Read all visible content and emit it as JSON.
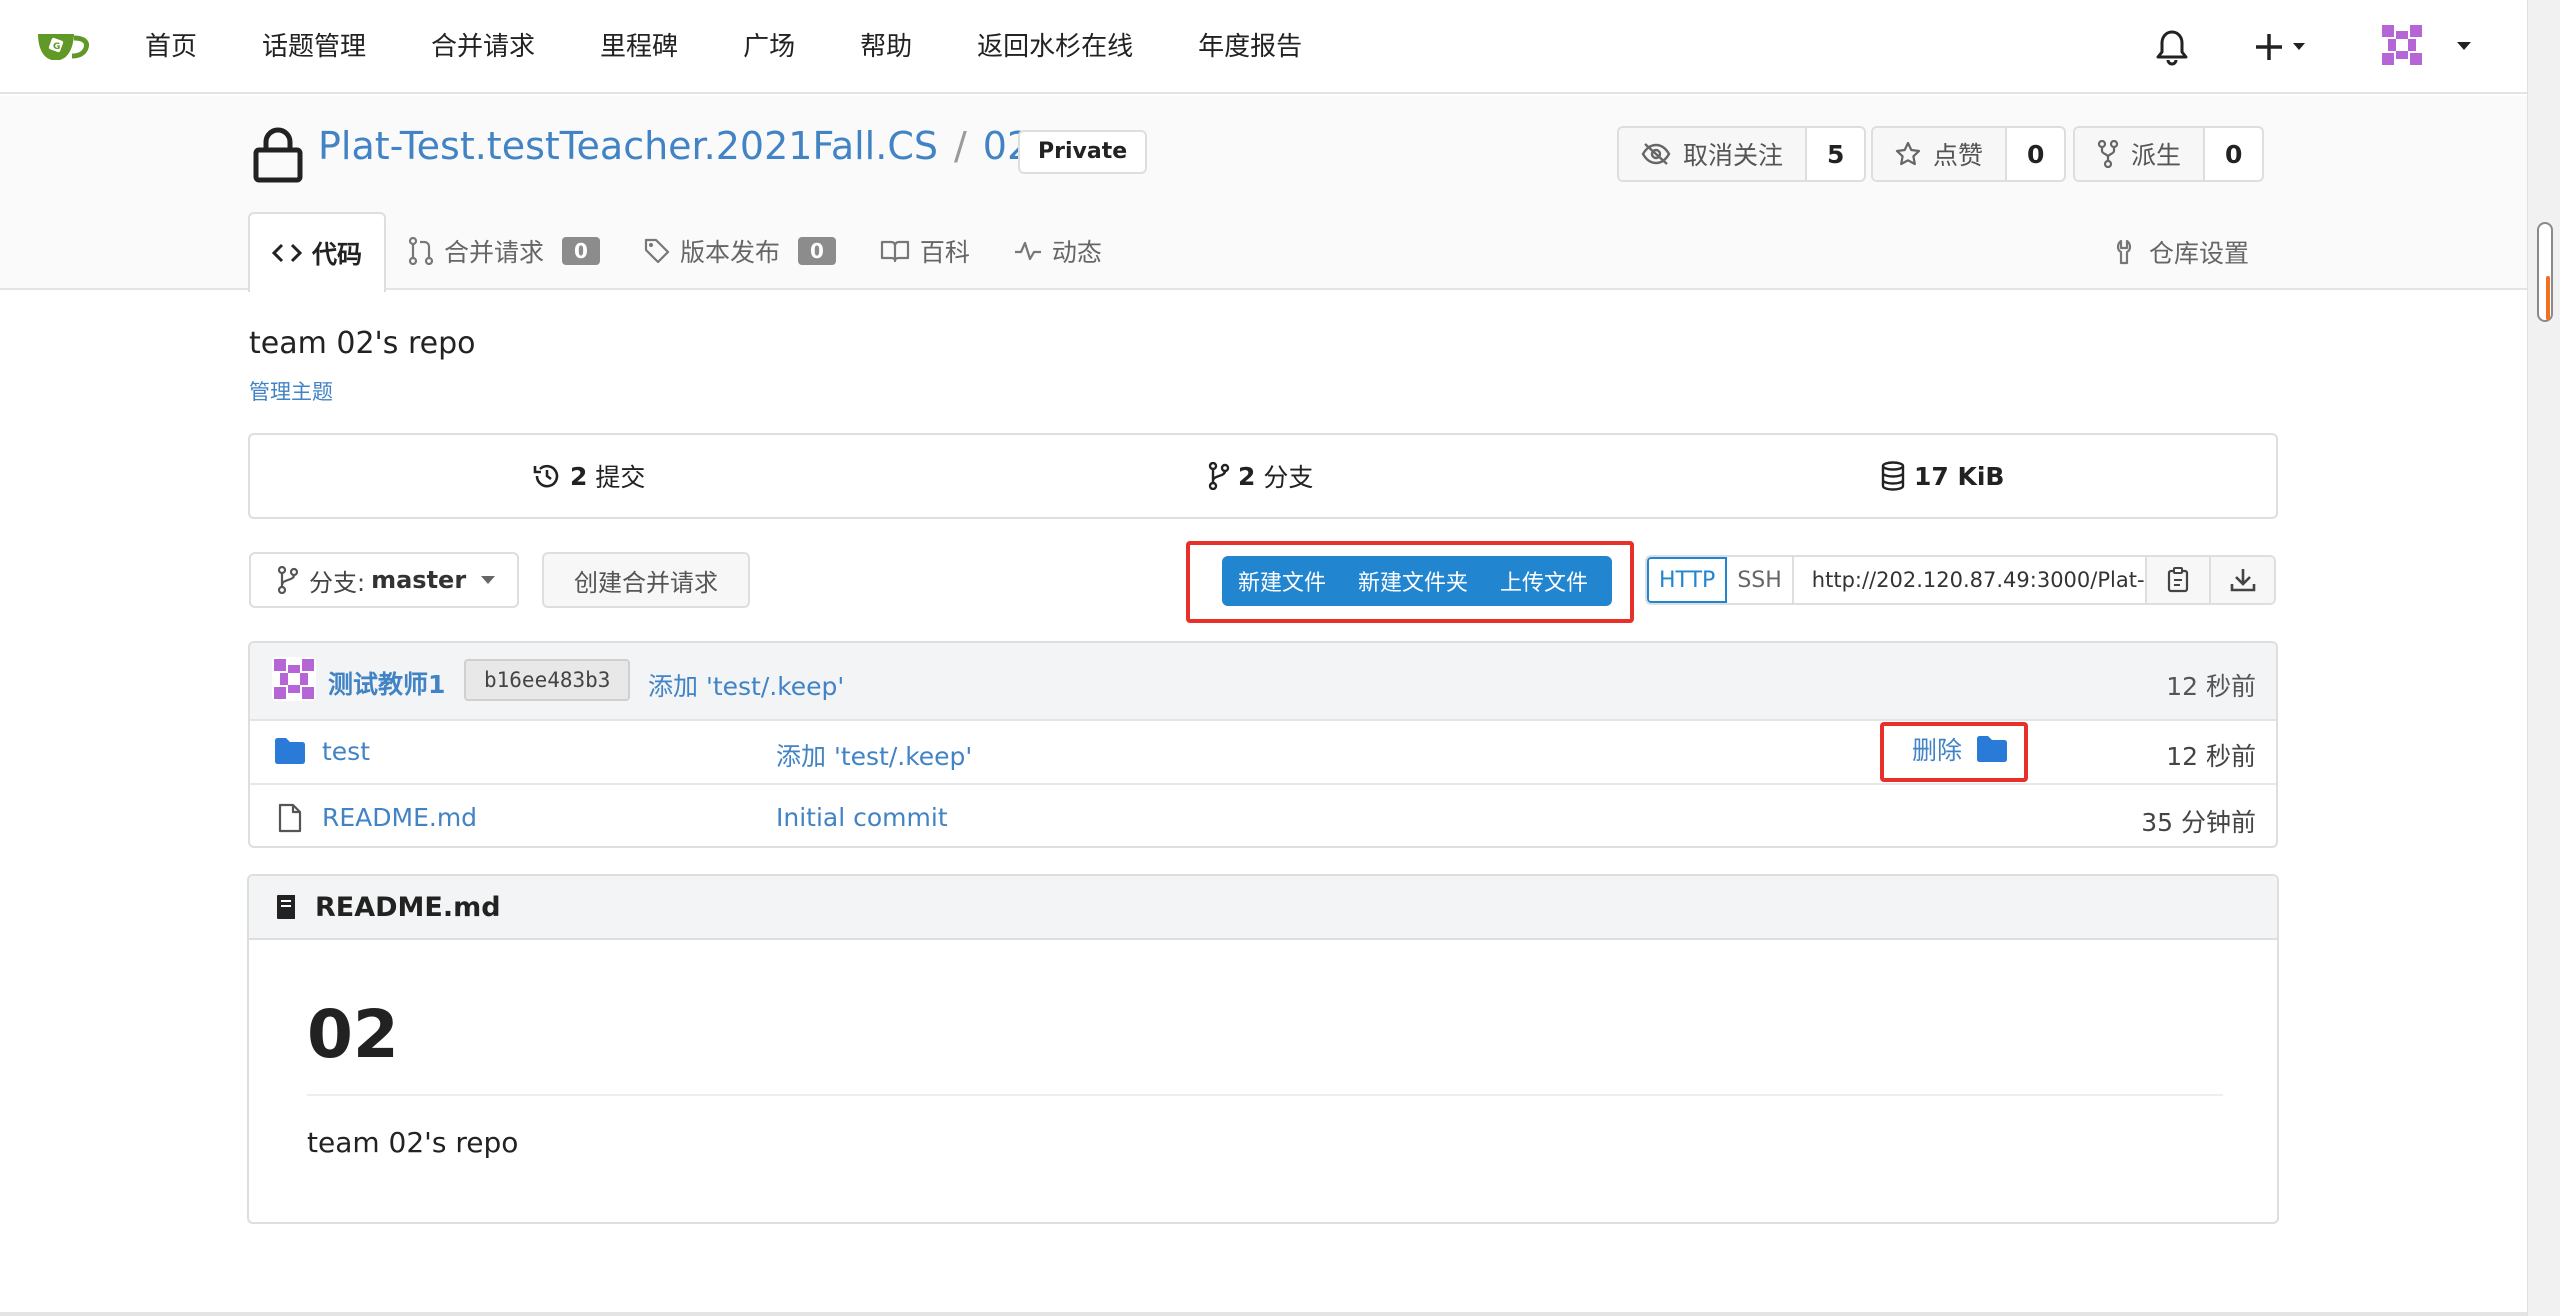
{
  "nav": {
    "items": [
      "首页",
      "话题管理",
      "合并请求",
      "里程碑",
      "广场",
      "帮助",
      "返回水杉在线",
      "年度报告"
    ]
  },
  "repo": {
    "owner": "Plat-Test.testTeacher.2021Fall.CS",
    "separator": "/",
    "name": "02",
    "visibility": "Private",
    "watch_label": "取消关注",
    "watch_count": "5",
    "star_label": "点赞",
    "star_count": "0",
    "fork_label": "派生",
    "fork_count": "0"
  },
  "tabs": {
    "code": "代码",
    "pulls": "合并请求",
    "pulls_count": "0",
    "releases": "版本发布",
    "releases_count": "0",
    "wiki": "百科",
    "activity": "动态",
    "settings": "仓库设置"
  },
  "description": "team 02's repo",
  "manage_topics": "管理主题",
  "stats": {
    "commits_count": "2",
    "commits_label": "提交",
    "branches_count": "2",
    "branches_label": "分支",
    "size": "17 KiB"
  },
  "controls": {
    "branch_prefix": "分支:",
    "branch_name": "master",
    "create_pr": "创建合并请求",
    "new_file": "新建文件",
    "new_folder": "新建文件夹",
    "upload_file": "上传文件",
    "http": "HTTP",
    "ssh": "SSH",
    "clone_url": "http://202.120.87.49:3000/Plat-"
  },
  "latest_commit": {
    "author": "测试教师1",
    "sha": "b16ee483b3",
    "message": "添加 'test/.keep'",
    "time": "12 秒前"
  },
  "files": [
    {
      "name": "test",
      "type": "folder",
      "message": "添加 'test/.keep'",
      "time": "12 秒前",
      "action": "删除"
    },
    {
      "name": "README.md",
      "type": "file",
      "message": "Initial commit",
      "time": "35 分钟前"
    }
  ],
  "readme": {
    "filename": "README.md",
    "heading": "02",
    "body": "team 02's repo"
  },
  "colors": {
    "link": "#4183c4",
    "primary": "#2185d0",
    "highlight": "#e8302a",
    "brand": "#609926"
  }
}
